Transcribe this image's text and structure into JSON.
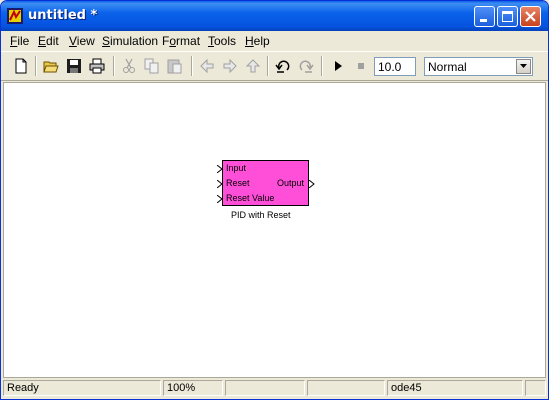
{
  "window": {
    "title": "untitled *"
  },
  "menu": {
    "items": [
      {
        "pre": "",
        "ul": "F",
        "post": "ile"
      },
      {
        "pre": "",
        "ul": "E",
        "post": "dit"
      },
      {
        "pre": "",
        "ul": "V",
        "post": "iew"
      },
      {
        "pre": "",
        "ul": "S",
        "post": "imulation"
      },
      {
        "pre": "F",
        "ul": "o",
        "post": "rmat"
      },
      {
        "pre": "",
        "ul": "T",
        "post": "ools"
      },
      {
        "pre": "",
        "ul": "H",
        "post": "elp"
      }
    ]
  },
  "toolbar": {
    "icons": [
      "new-icon",
      "open-icon",
      "save-icon",
      "print-icon",
      "cut-icon",
      "copy-icon",
      "paste-icon",
      "back-icon",
      "forward-icon",
      "up-icon",
      "undo-icon",
      "redo-icon",
      "start-icon",
      "stop-icon"
    ],
    "stop_time": "10.0",
    "sim_mode": "Normal"
  },
  "block": {
    "name": "PID with Reset",
    "color": "#FF4FD8",
    "inputs": [
      "Input",
      "Reset",
      "Reset Value"
    ],
    "output": "Output"
  },
  "status": {
    "state": "Ready",
    "zoom": "100%",
    "cell3": "",
    "cell4": "",
    "solver": "ode45",
    "cell6": ""
  }
}
